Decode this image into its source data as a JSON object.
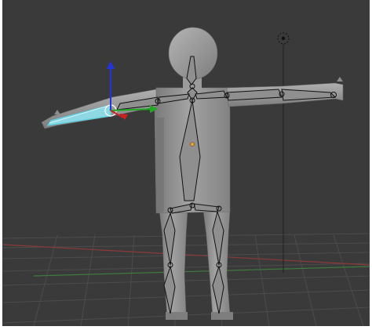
{
  "app": {
    "view": "3d-viewport",
    "mode": "pose-mode"
  },
  "viewport": {
    "background_color": "#3a3a3a",
    "grid_color": "#4a4a4a",
    "x_axis_color": "#8a3a3a",
    "y_axis_color": "#3f7a3f"
  },
  "scene": {
    "character": "humanoid-mesh-with-armature",
    "selected_bone": "left-forearm-bone",
    "active_gizmo": "translate-gizmo",
    "mesh_color": "#9a9a9a",
    "bone_outline_color": "#111111",
    "selected_bone_color": "#5fd0e0",
    "gizmo_x_color": "#cc2222",
    "gizmo_y_color": "#22aa22",
    "gizmo_z_color": "#2233dd",
    "lamp": "point-lamp",
    "origin_marker": "object-origin"
  }
}
